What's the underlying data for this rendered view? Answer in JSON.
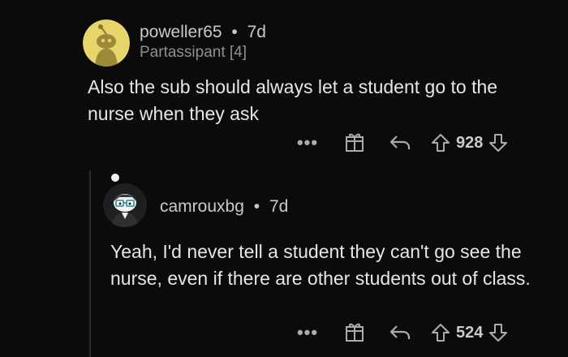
{
  "comments": [
    {
      "username": "poweller65",
      "separator": "•",
      "age": "7d",
      "flair": "Partassipant [4]",
      "body": "Also the sub should always let a student go to the nurse when they ask",
      "votes": "928",
      "avatar_color": "#e7d46a"
    },
    {
      "username": "camrouxbg",
      "separator": "•",
      "age": "7d",
      "body": "Yeah, I'd never tell a student they can't go see the nurse, even if there are other students out of class.",
      "votes": "524"
    }
  ],
  "icons": {
    "more": "more-options-icon",
    "award": "award-icon",
    "reply": "reply-icon",
    "upvote": "upvote-arrow-icon",
    "downvote": "downvote-arrow-icon"
  }
}
